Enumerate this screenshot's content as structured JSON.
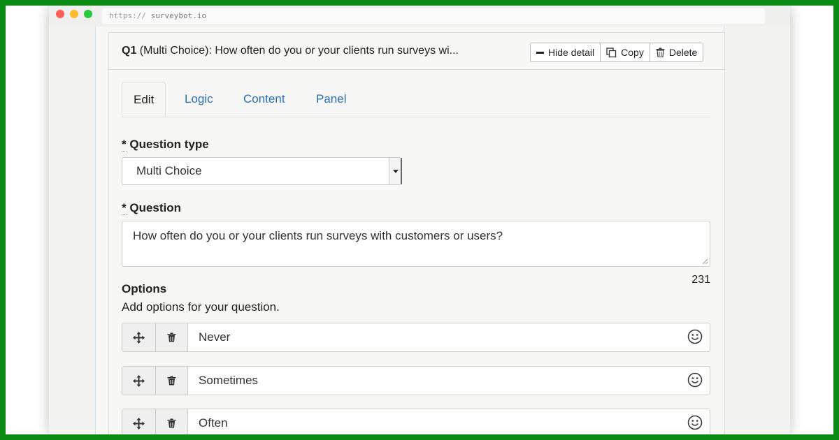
{
  "browser": {
    "url_protocol": "https://",
    "url_host": "surveybot.io"
  },
  "question_card": {
    "number": "Q1",
    "title_rest": " (Multi Choice): How often do you or your clients run surveys wi...",
    "buttons": {
      "hide_detail": "Hide detail",
      "copy": "Copy",
      "delete": "Delete"
    }
  },
  "tabs": [
    {
      "label": "Edit",
      "active": true
    },
    {
      "label": "Logic"
    },
    {
      "label": "Content"
    },
    {
      "label": "Panel"
    }
  ],
  "form": {
    "required_mark": "*",
    "question_type_label": " Question type",
    "question_type_value": "Multi Choice",
    "question_label": " Question",
    "question_value": "How often do you or your clients run surveys with customers or users?",
    "char_counter": "231",
    "options_label": "Options",
    "options_help": "Add options for your question.",
    "options": [
      "Never",
      "Sometimes",
      "Often"
    ]
  },
  "colors": {
    "border_green": "#0a8a12",
    "link_blue": "#2a6fb5"
  },
  "icons": {
    "move": "move-arrows-icon",
    "trash": "trash-icon",
    "emoji": "smiley-icon",
    "minus": "minus-icon",
    "copy": "copy-icon"
  }
}
